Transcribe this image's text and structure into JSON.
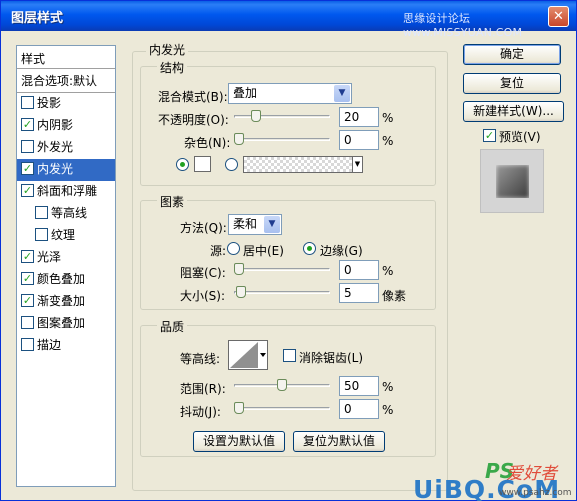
{
  "window": {
    "title": "图层样式",
    "watermark": "思缘设计论坛 www.MISSYUAN.COM",
    "close_label": "✕"
  },
  "style_list": {
    "header": "样式",
    "blend_options": "混合选项:默认",
    "items": [
      {
        "label": "投影",
        "checked": false,
        "selected": false,
        "indent": "top"
      },
      {
        "label": "内阴影",
        "checked": true,
        "selected": false,
        "indent": "top"
      },
      {
        "label": "外发光",
        "checked": false,
        "selected": false,
        "indent": "top"
      },
      {
        "label": "内发光",
        "checked": true,
        "selected": true,
        "indent": "top"
      },
      {
        "label": "斜面和浮雕",
        "checked": true,
        "selected": false,
        "indent": "top"
      },
      {
        "label": "等高线",
        "checked": false,
        "selected": false,
        "indent": "sub"
      },
      {
        "label": "纹理",
        "checked": false,
        "selected": false,
        "indent": "sub"
      },
      {
        "label": "光泽",
        "checked": true,
        "selected": false,
        "indent": "top"
      },
      {
        "label": "颜色叠加",
        "checked": true,
        "selected": false,
        "indent": "top"
      },
      {
        "label": "渐变叠加",
        "checked": true,
        "selected": false,
        "indent": "top"
      },
      {
        "label": "图案叠加",
        "checked": false,
        "selected": false,
        "indent": "top"
      },
      {
        "label": "描边",
        "checked": false,
        "selected": false,
        "indent": "top"
      }
    ]
  },
  "panel": {
    "title": "内发光",
    "structure": {
      "title": "结构",
      "blend_mode_label": "混合模式(B):",
      "blend_mode_value": "叠加",
      "opacity_label": "不透明度(O):",
      "opacity_value": "20",
      "opacity_unit": "%",
      "opacity_fraction": 0.2,
      "noise_label": "杂色(N):",
      "noise_value": "0",
      "noise_unit": "%",
      "noise_fraction": 0.0,
      "color_mode": "solid"
    },
    "elements": {
      "title": "图素",
      "technique_label": "方法(Q):",
      "technique_value": "柔和",
      "source_label": "源:",
      "source_center": "居中(E)",
      "source_edge": "边缘(G)",
      "source_selected": "edge",
      "choke_label": "阻塞(C):",
      "choke_value": "0",
      "choke_unit": "%",
      "choke_fraction": 0.0,
      "size_label": "大小(S):",
      "size_value": "5",
      "size_unit": "像素",
      "size_fraction": 0.02
    },
    "quality": {
      "title": "品质",
      "contour_label": "等高线:",
      "antialias_label": "消除锯齿(L)",
      "antialias_checked": false,
      "range_label": "范围(R):",
      "range_value": "50",
      "range_unit": "%",
      "range_fraction": 0.5,
      "jitter_label": "抖动(J):",
      "jitter_value": "0",
      "jitter_unit": "%",
      "jitter_fraction": 0.0
    },
    "buttons": {
      "make_default": "设置为默认值",
      "reset_default": "复位为默认值"
    }
  },
  "actions": {
    "ok": "确定",
    "reset": "复位",
    "new_style": "新建样式(W)...",
    "preview_label": "预览(V)",
    "preview_checked": true
  },
  "watermarks": {
    "ps": "PS",
    "hz": "爱好者",
    "uibo": "UiBQ.CoM",
    "url": "www.psahz.com"
  },
  "colors": {
    "titlebar": "#0058ee",
    "selection": "#316ac5",
    "check": "#21a121",
    "dialog_bg": "#ece9d8"
  }
}
